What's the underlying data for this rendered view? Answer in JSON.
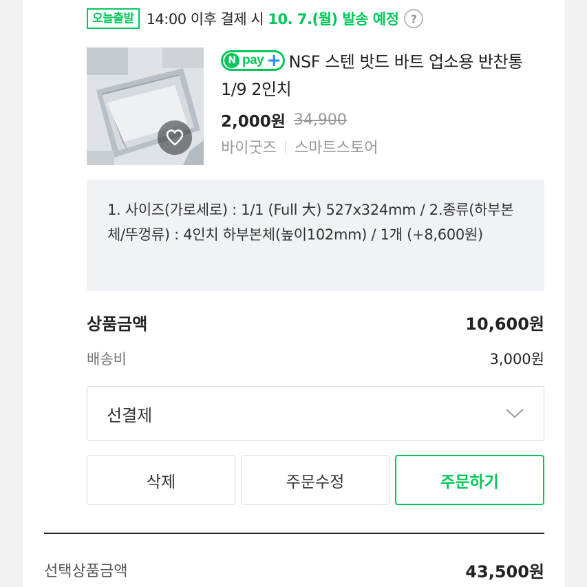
{
  "shipping": {
    "badge": "오늘출발",
    "text": "14:00 이후 결제 시",
    "date": "10. 7.(월) 발송 예정",
    "help_icon": "?"
  },
  "product": {
    "npay_n": "N",
    "npay_text": "pay",
    "npay_plus": "+",
    "name": "NSF 스텐 밧드 바트 업소용 반찬통 1/9 2인치",
    "price": "2,000원",
    "original_price": "34,900",
    "seller": "바이굿즈",
    "store": "스마트스토어",
    "image_icon": "heart-icon"
  },
  "option": {
    "text": "1. 사이즈(가로세로) : 1/1 (Full 大) 527x324mm / 2.종류(하부본체/뚜껑류) : 4인치 하부본체(높이102mm) / 1개 (+8,600원)"
  },
  "summary": {
    "product_amount_label": "상품금액",
    "product_amount_value": "10,600원",
    "shipping_fee_label": "배송비",
    "shipping_fee_value": "3,000원"
  },
  "payment_select": {
    "value": "선결제"
  },
  "buttons": {
    "delete": "삭제",
    "modify": "주문수정",
    "order": "주문하기"
  },
  "total": {
    "label": "선택상품금액",
    "value": "43,500원"
  },
  "colors": {
    "accent": "#03c75a",
    "npay_plus": "#1e90ff",
    "muted": "#999999"
  }
}
